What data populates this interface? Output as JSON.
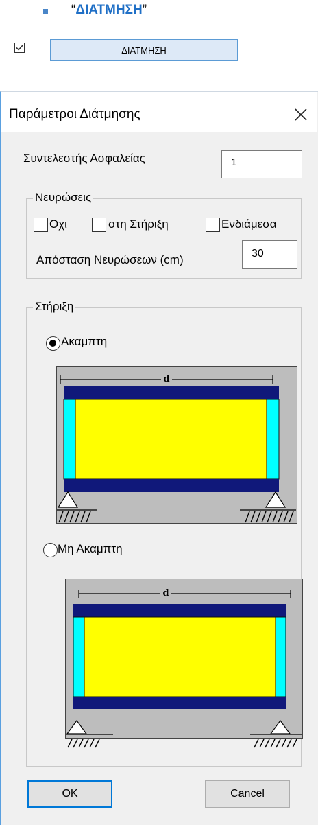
{
  "document": {
    "quote_open": "“",
    "heading": "ΔΙΑΤΜΗΣΗ",
    "quote_close": "”",
    "top_button_label": "ΔΙΑΤΜΗΣΗ",
    "top_checkbox_checked": true
  },
  "dialog": {
    "title": "Παράμετροι Διάτμησης",
    "safety_factor": {
      "label": "Συντελεστής Ασφαλείας",
      "value": "1"
    },
    "ribs": {
      "legend": "Νευρώσεις",
      "options": [
        {
          "label": "Οχι",
          "checked": false
        },
        {
          "label": "στη Στήριξη",
          "checked": false
        },
        {
          "label": "Ενδιάμεσα",
          "checked": false
        }
      ],
      "spacing_label": "Απόσταση Νευρώσεων (cm)",
      "spacing_value": "30"
    },
    "support": {
      "legend": "Στήριξη",
      "options": [
        {
          "label": "Ακαμπτη",
          "selected": true
        },
        {
          "label": "Μη Ακαμπτη",
          "selected": false
        }
      ],
      "diagram_dimension_label": "d"
    },
    "ok_label": "OK",
    "cancel_label": "Cancel"
  },
  "colors": {
    "flange": "#10187a",
    "web": "#ffff00",
    "stiffener": "#00ffff",
    "panel_bg": "#bdbdbd",
    "accent": "#0078d7",
    "heading": "#1f6fc6"
  }
}
